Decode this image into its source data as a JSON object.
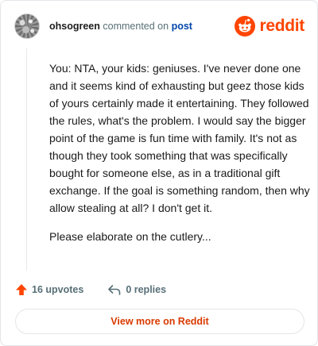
{
  "header": {
    "username": "ohsogreen",
    "commented_on": "commented on",
    "post_link": "post",
    "brand": "reddit"
  },
  "comment": {
    "paragraphs": [
      "You: NTA, your kids: geniuses. I've never done one and it seems kind of exhausting but geez those kids of yours certainly made it entertaining. They followed the rules, what's the problem. I would say the bigger point of the game is fun time with family. It's not as though they took something that was specifically bought for someone else, as in a traditional gift exchange. If the goal is something random, then why allow stealing at all? I don't get it.",
      "Please elaborate on the cutlery..."
    ]
  },
  "actions": {
    "upvotes": "16 upvotes",
    "replies": "0 replies"
  },
  "footer": {
    "view_more": "View more on Reddit"
  },
  "colors": {
    "brand": "#ff4500",
    "link": "#0045ac",
    "muted": "#576f76",
    "view_more": "#d93a00"
  },
  "icons": [
    "avatar",
    "reddit-snoo-icon",
    "upvote-arrow-icon",
    "reply-arrow-icon"
  ]
}
